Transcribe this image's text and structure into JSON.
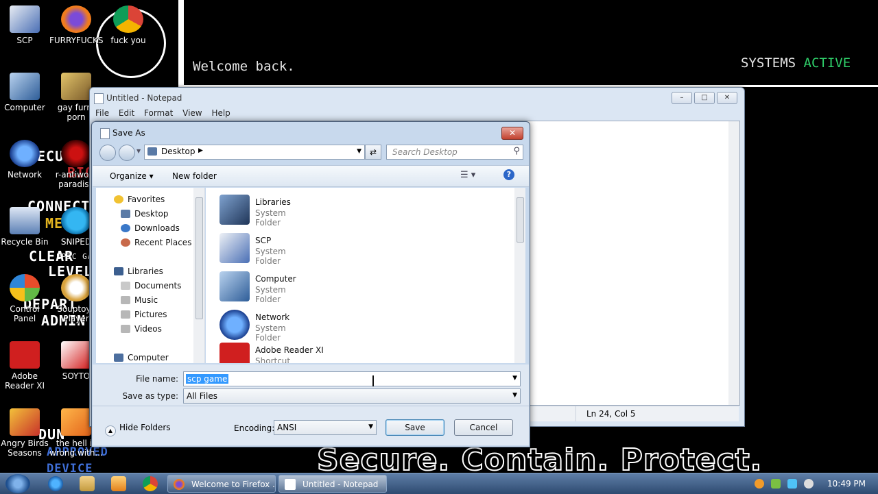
{
  "desktop": {
    "terminal_greeting": "Welcome back.",
    "status_prefix": "SYSTEMS",
    "status_value": "ACTIVE",
    "tagline": "Secure. Contain. Protect.",
    "icons": [
      {
        "label": "SCP"
      },
      {
        "label": "FURRYFUCKS"
      },
      {
        "label": "fuck you"
      },
      {
        "label": "Computer"
      },
      {
        "label": "gay furry porn"
      },
      {
        "label": "Network"
      },
      {
        "label": "r-antiwork paradise"
      },
      {
        "label": "Recycle Bin"
      },
      {
        "label": "SNIPED"
      },
      {
        "label": "Control Panel"
      },
      {
        "label": "Souptoys Player"
      },
      {
        "label": "Adobe Reader XI"
      },
      {
        "label": "SOYTO"
      },
      {
        "label": "Angry Birds Seasons"
      },
      {
        "label": "the hell is wrong with..."
      }
    ],
    "ghost_text": [
      "ECU",
      "BIOME",
      "CONNECT",
      "ME",
      "CLEAR",
      "LEVEL",
      "DEPART",
      "ADMIN",
      "DUN",
      "APPROVED",
      "DEVICE",
      "EPIC GA"
    ]
  },
  "notepad": {
    "title": "Untitled - Notepad",
    "menu": [
      "File",
      "Edit",
      "Format",
      "View",
      "Help"
    ],
    "status": "Ln 24, Col 5"
  },
  "save_dialog": {
    "title": "Save As",
    "address": "Desktop",
    "search_placeholder": "Search Desktop",
    "organize_label": "Organize",
    "new_folder_label": "New folder",
    "nav": {
      "favorites": "Favorites",
      "favorites_items": [
        "Desktop",
        "Downloads",
        "Recent Places"
      ],
      "libraries": "Libraries",
      "libraries_items": [
        "Documents",
        "Music",
        "Pictures",
        "Videos"
      ],
      "computer": "Computer"
    },
    "files": [
      {
        "name": "Libraries",
        "type": "System Folder"
      },
      {
        "name": "SCP",
        "type": "System Folder"
      },
      {
        "name": "Computer",
        "type": "System Folder"
      },
      {
        "name": "Network",
        "type": "System Folder"
      },
      {
        "name": "Adobe Reader XI",
        "type": "Shortcut"
      }
    ],
    "file_name_label": "File name:",
    "file_name_value": "scp game",
    "save_type_label": "Save as type:",
    "save_type_value": "All Files",
    "hide_folders_label": "Hide Folders",
    "encoding_label": "Encoding:",
    "encoding_value": "ANSI",
    "save_label": "Save",
    "cancel_label": "Cancel"
  },
  "taskbar": {
    "tasks": [
      "Welcome to Firefox ...",
      "Untitled - Notepad"
    ],
    "clock": "10:49 PM"
  },
  "colors": {
    "status_active": "#2fd06a",
    "selection": "#3399ff",
    "taskbar": "#3a5a85"
  }
}
